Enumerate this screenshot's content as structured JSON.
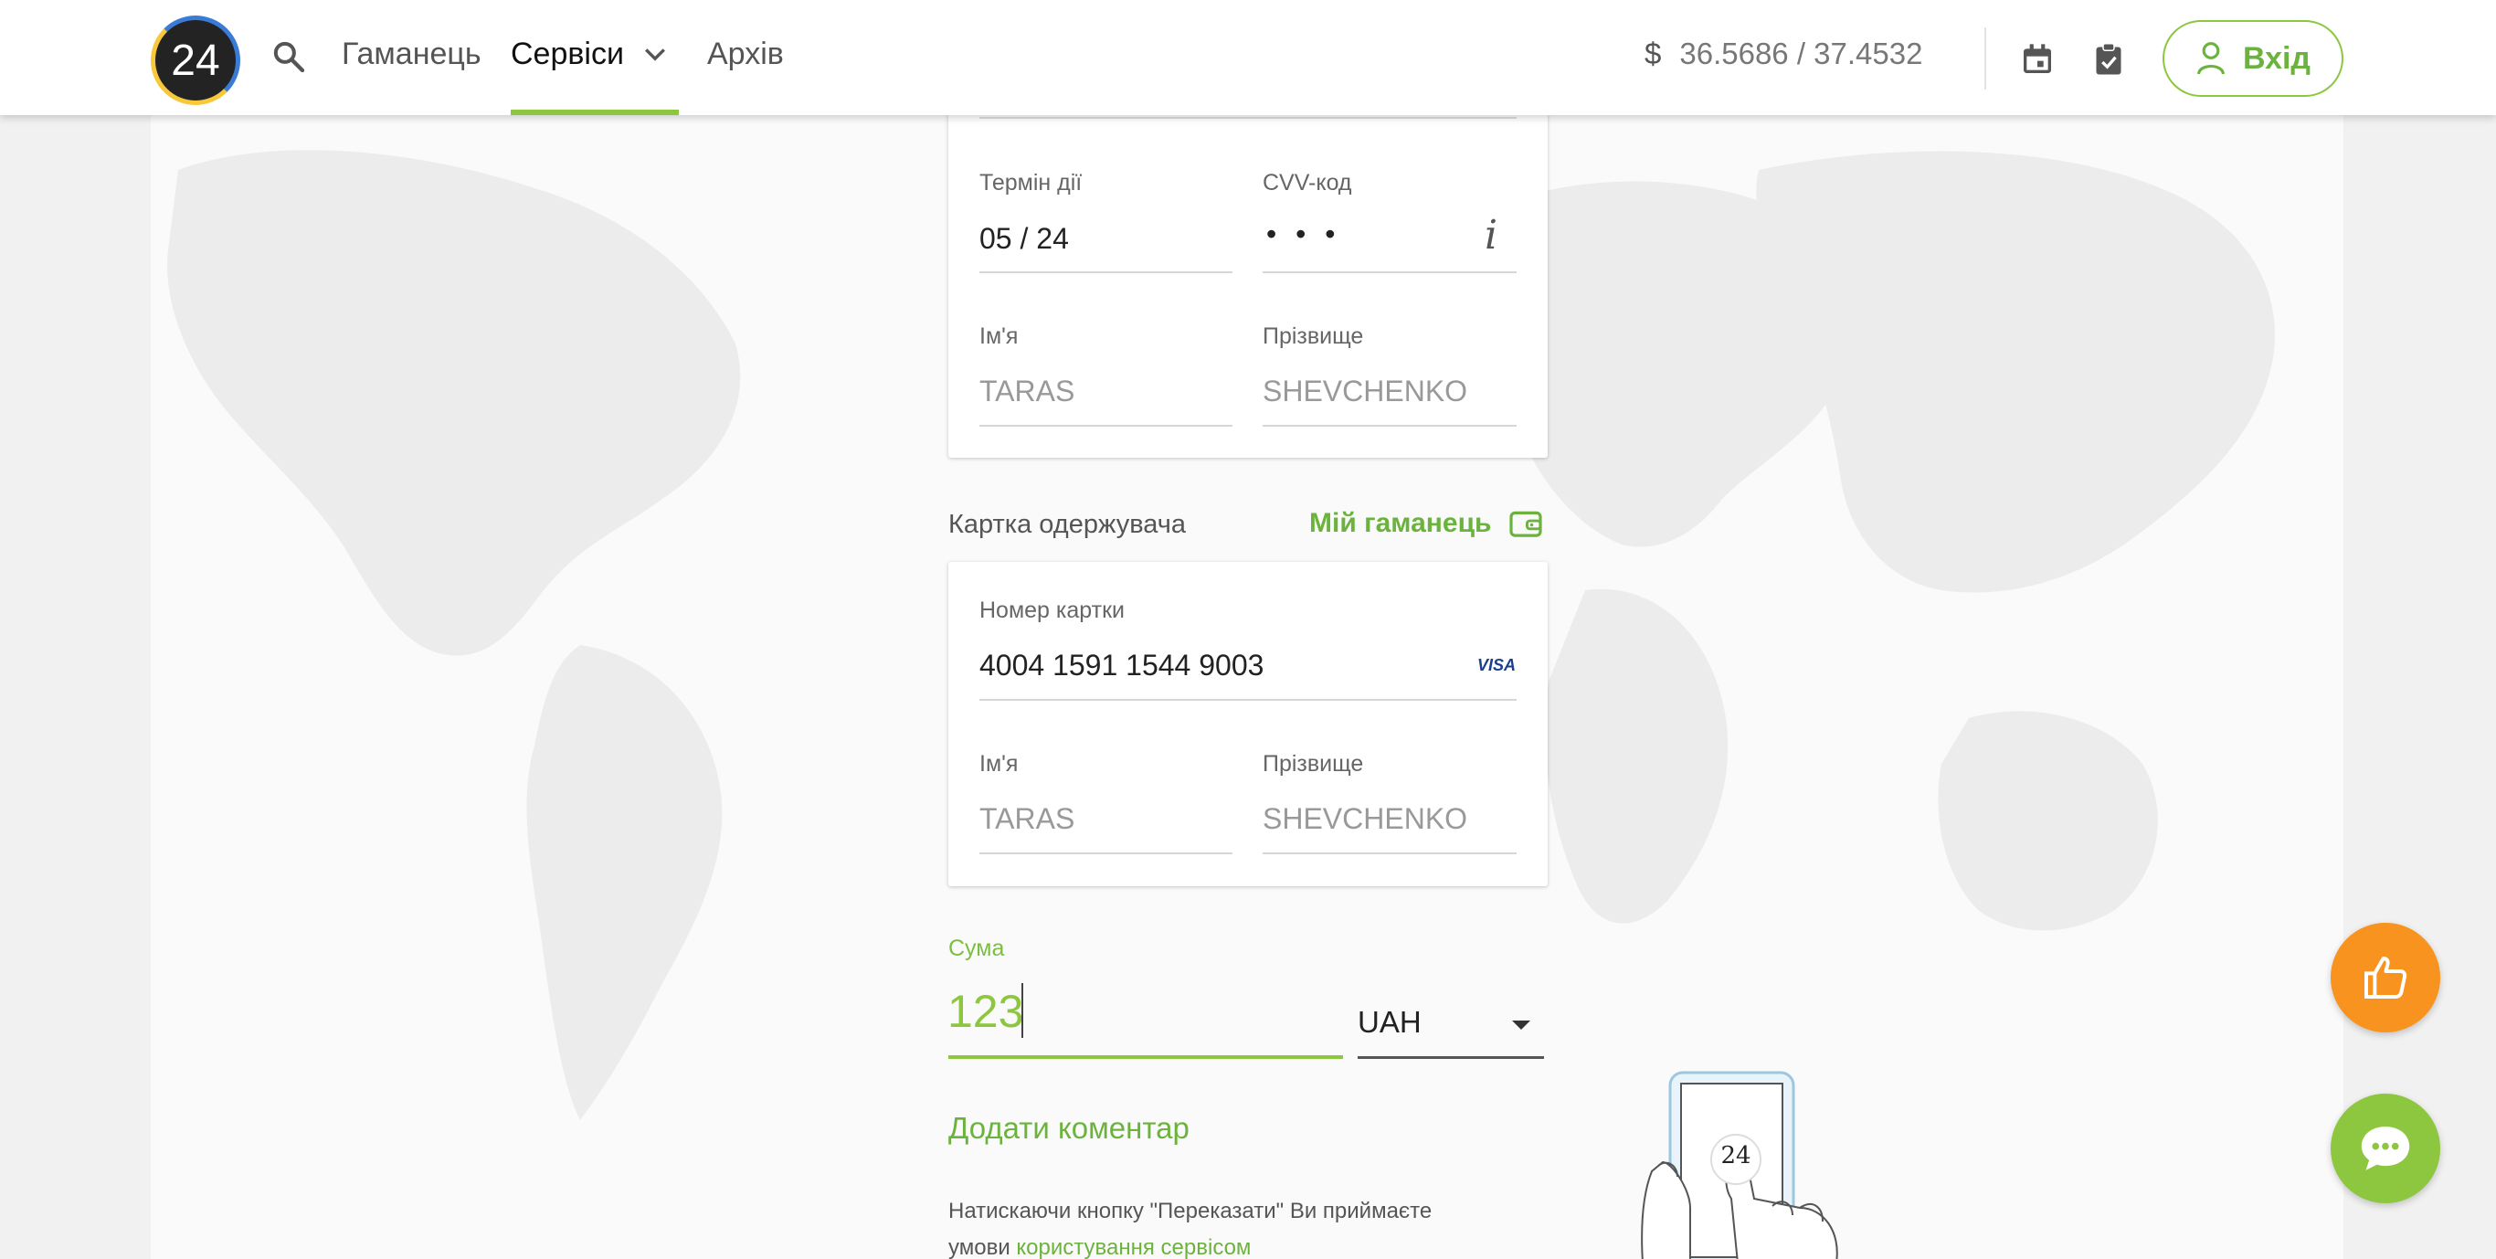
{
  "header": {
    "logo_text": "24",
    "nav": {
      "wallet": "Гаманець",
      "services": "Сервіси",
      "archive": "Архів"
    },
    "rate_symbol": "$",
    "rate": "36.5686 / 37.4532",
    "login_label": "Вхід"
  },
  "sender_card": {
    "expiry_label": "Термін дії",
    "expiry_value": "05 / 24",
    "cvv_label": "CVV-код",
    "cvv_value": "• • •",
    "info_glyph": "i",
    "first_name_label": "Ім'я",
    "first_name_placeholder": "TARAS",
    "last_name_label": "Прізвище",
    "last_name_placeholder": "SHEVCHENKO"
  },
  "recipient": {
    "section_label": "Картка одержувача",
    "my_wallet_link": "Мій гаманець",
    "card_number_label": "Номер картки",
    "card_number_value": "4004 1591 1544 9003",
    "card_brand": "VISA",
    "first_name_label": "Ім'я",
    "first_name_placeholder": "TARAS",
    "last_name_label": "Прізвище",
    "last_name_placeholder": "SHEVCHENKO"
  },
  "amount": {
    "label": "Сума",
    "value": "123",
    "currency": "UAH"
  },
  "add_comment": "Додати коментар",
  "terms": {
    "text": "Натискаючи кнопку \"Переказати\" Ви приймаєте умови",
    "link": "користування сервісом"
  },
  "phone_badge": "24",
  "icons": {
    "search": "search-icon",
    "chevron": "chevron-down-icon",
    "calendar": "calendar-icon",
    "clipboard": "clipboard-check-icon",
    "user": "user-icon",
    "wallet": "wallet-icon",
    "info": "info-icon",
    "dropdown": "dropdown-arrow-icon",
    "like": "thumbs-up-icon",
    "chat": "chat-icon"
  },
  "colors": {
    "accent_green": "#8dc63f",
    "link_green": "#6cb33e",
    "orange": "#f7931e"
  }
}
